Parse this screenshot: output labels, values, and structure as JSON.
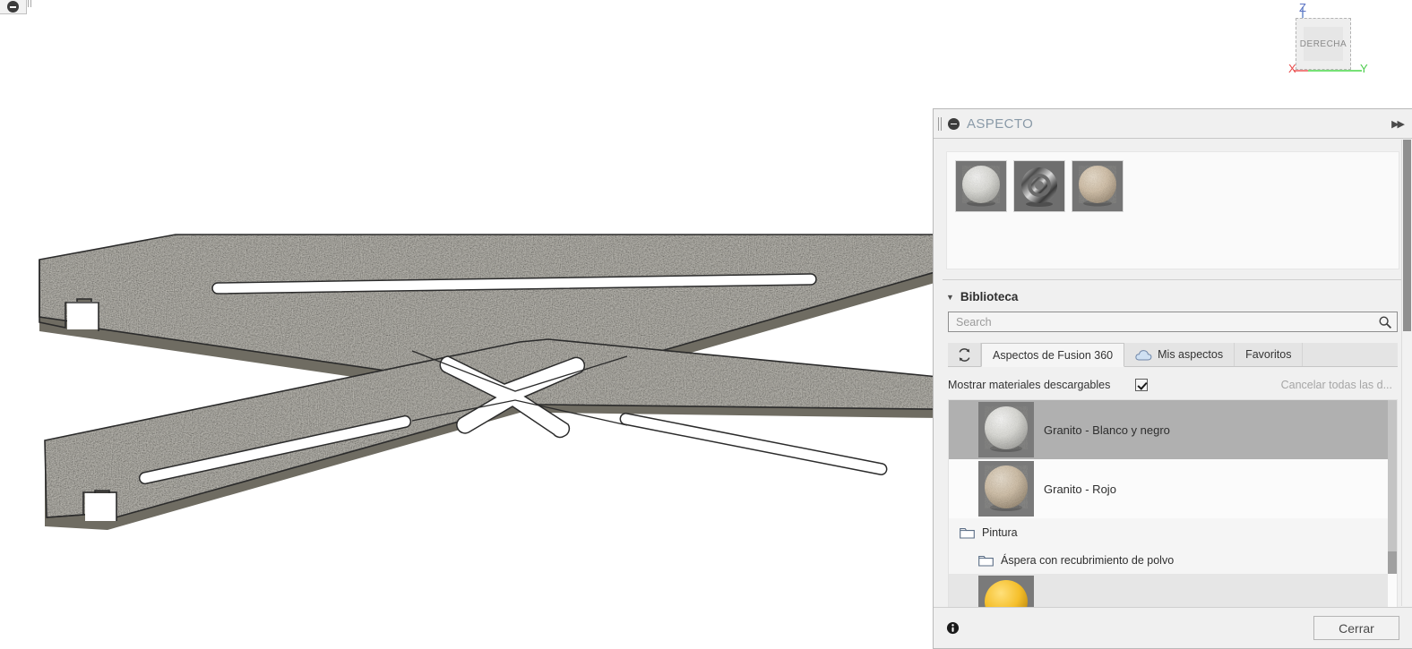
{
  "app": {
    "viewport_background": "#ffffff"
  },
  "toolbar_stub": {
    "collapse_icon": "minus-circle-icon",
    "grip": "drag-grip-handle"
  },
  "viewcube": {
    "face_label": "DERECHA",
    "axes": [
      {
        "name": "Z",
        "label": "Z",
        "color": "#5b73c4"
      },
      {
        "name": "Y",
        "label": "Y",
        "color": "#4ccc4c"
      },
      {
        "name": "X",
        "label": "X",
        "color": "#e84c4c"
      }
    ]
  },
  "model": {
    "name": "x-brace-sheet-metal-part",
    "material_applied": "Granito - Blanco y negro",
    "edge_color": "#2b2b2b",
    "fill_base": "#a9a498"
  },
  "panel": {
    "title": "ASPECTO",
    "title_color": "#8a9aa8",
    "collapse_icon": "minus-circle-icon",
    "expand_icon": "double-chevron-right-icon",
    "grip_icon": "drag-grip-handle",
    "applied_swatches": [
      {
        "name": "Granito - Blanco y negro",
        "type": "sphere",
        "color": "#d8d8d4"
      },
      {
        "name": "Acero - Cromado",
        "type": "torus",
        "color": "#9a9a9a"
      },
      {
        "name": "Granito - Rojo",
        "type": "sphere",
        "color": "#d9c6ac"
      }
    ],
    "library": {
      "section_label": "Biblioteca",
      "collapse_arrow": "triangle-down-icon",
      "search": {
        "placeholder": "Search",
        "value": "",
        "icon": "search-icon"
      },
      "tabs": [
        {
          "id": "refresh",
          "label": "",
          "icon": "refresh-icon",
          "active": false
        },
        {
          "id": "fusion",
          "label": "Aspectos de Fusion 360",
          "icon": "",
          "active": true
        },
        {
          "id": "mine",
          "label": "Mis aspectos",
          "icon": "cloud-icon",
          "active": false
        },
        {
          "id": "favorites",
          "label": "Favoritos",
          "icon": "",
          "active": false
        }
      ],
      "show_downloadable_label": "Mostrar materiales descargables",
      "show_downloadable_checked": true,
      "cancel_downloads_label": "Cancelar todas las d...",
      "cancel_downloads_enabled": false,
      "items": [
        {
          "kind": "material",
          "label": "Granito - Blanco y negro",
          "selected": true,
          "swatch_color": "#d6d6d2"
        },
        {
          "kind": "material",
          "label": "Granito - Rojo",
          "selected": false,
          "swatch_color": "#d6c2a8"
        },
        {
          "kind": "folder",
          "label": "Pintura",
          "indent": 0,
          "icon": "folder-icon"
        },
        {
          "kind": "folder",
          "label": "Áspera con recubrimiento de polvo",
          "indent": 1,
          "icon": "folder-icon"
        },
        {
          "kind": "material-partial",
          "label": "",
          "selected": false,
          "swatch_color": "#f2bb2c"
        }
      ],
      "selection_highlight_color": "#b0b0b0"
    },
    "footer": {
      "info_icon": "info-icon",
      "close_label": "Cerrar"
    }
  }
}
